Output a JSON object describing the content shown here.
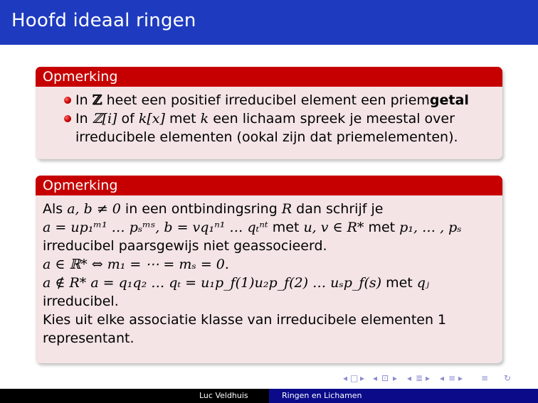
{
  "slide": {
    "title": "Hoofd ideaal ringen"
  },
  "block1": {
    "heading": "Opmerking",
    "item1": {
      "pre": "In ",
      "Z": "ℤ",
      "mid": " heet een positief irreducibel element een priem",
      "bold": "getal"
    },
    "item2": {
      "pre": "In ",
      "Zi": "ℤ[i]",
      "of": " of ",
      "kx": "k[x]",
      "met": " met ",
      "k": "k",
      "rest1": " een lichaam spreek je meestal over",
      "rest2": "irreducibele elementen (ookal zijn dat priemelementen)."
    }
  },
  "block2": {
    "heading": "Opmerking",
    "l1a": "Als ",
    "l1m1": "a, b ≠ 0",
    "l1b": " in een ontbindingsring ",
    "l1m2": "R",
    "l1c": " dan schrijf je",
    "l2m1": "a = up₁ᵐ¹ … pₛᵐˢ,  b = vq₁ⁿ¹ … qₜⁿᵗ",
    "l2a": " met ",
    "l2m2": "u, v ∈ R*",
    "l2b": " met ",
    "l2m3": "p₁, … , pₛ",
    "l3": "irreducibel paarsgewijs niet geassocieerd.",
    "l4m": "a ∈ ℝ* ⇔ m₁ = ⋯ = mₛ = 0.",
    "l5m": "a ∉ R*  a = q₁q₂ … qₜ = u₁p_f(1)u₂p_f(2) … uₛp_f(s)",
    "l5a": " met ",
    "l5m2": "qⱼ",
    "l6": "irreducibel.",
    "l7": "Kies uit elke associatie klasse van irreducibele elementen 1",
    "l8": "representant."
  },
  "footer": {
    "author": "Luc Veldhuis",
    "title": "Ringen en Lichamen"
  },
  "nav": {
    "frame_prev": "◂",
    "frame_icon": "□",
    "frame_next": "▸",
    "sub_prev": "◂",
    "sub_icon": "⊡",
    "sub_next": "▸",
    "sec_prev": "◂",
    "sec_icon": "≣",
    "sec_next": "▸",
    "doc_prev": "◂",
    "doc_icon": "≡",
    "doc_next": "▸",
    "toc_icon": "≡",
    "search_icon": "↻"
  }
}
